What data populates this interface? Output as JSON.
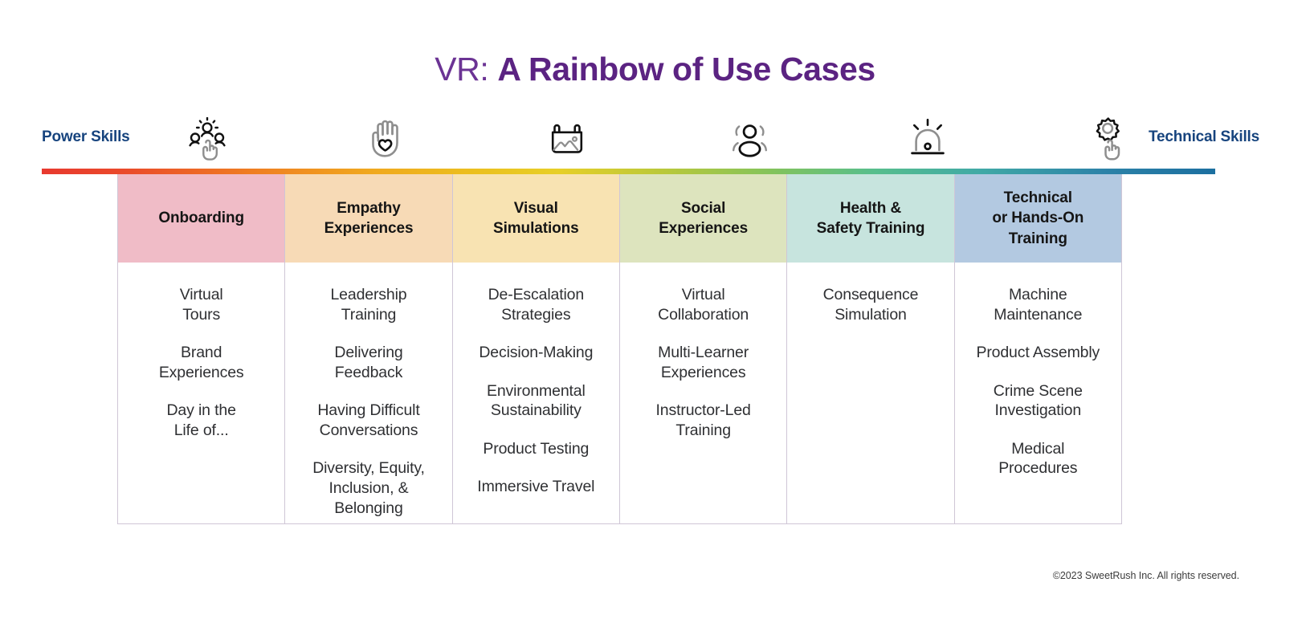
{
  "title": {
    "prefix": "VR: ",
    "main": "A Rainbow of Use Cases",
    "prefix_color": "#6b3394",
    "main_color": "#5b2382"
  },
  "axis": {
    "left_label": "Power Skills",
    "right_label": "Technical Skills",
    "label_color": "#17447e",
    "gradient_stops": [
      "#e8392f",
      "#ef7e22",
      "#f0a81f",
      "#ebc01f",
      "#b9c83b",
      "#84c35b",
      "#41a9a6",
      "#1c6fa0"
    ]
  },
  "icons": [
    {
      "name": "team-people-pointer-icon",
      "alt": "group of three people with pointing hand"
    },
    {
      "name": "hand-heart-icon",
      "alt": "open hand with heart in palm"
    },
    {
      "name": "landscape-picture-icon",
      "alt": "hanging picture of a landscape"
    },
    {
      "name": "social-avatars-icon",
      "alt": "two overlapping person avatars"
    },
    {
      "name": "alarm-siren-icon",
      "alt": "emergency siren light with rays"
    },
    {
      "name": "gear-hand-icon",
      "alt": "gear with pointing hand"
    }
  ],
  "columns": [
    {
      "header": "Onboarding",
      "header_lines": [
        "Onboarding"
      ],
      "color": "#f0bcc7",
      "items": [
        "Virtual\nTours",
        "Brand\nExperiences",
        "Day in the\nLife of..."
      ]
    },
    {
      "header": "Empathy Experiences",
      "header_lines": [
        "Empathy",
        "Experiences"
      ],
      "color": "#f7dab6",
      "items": [
        "Leadership\nTraining",
        "Delivering\nFeedback",
        "Having Difficult\nConversations",
        "Diversity, Equity,\nInclusion, &\nBelonging"
      ]
    },
    {
      "header": "Visual Simulations",
      "header_lines": [
        "Visual",
        "Simulations"
      ],
      "color": "#f8e3b2",
      "items": [
        "De-Escalation\nStrategies",
        "Decision-Making",
        "Environmental\nSustainability",
        "Product Testing",
        "Immersive Travel"
      ]
    },
    {
      "header": "Social Experiences",
      "header_lines": [
        "Social",
        "Experiences"
      ],
      "color": "#dde4be",
      "items": [
        "Virtual\nCollaboration",
        "Multi-Learner\nExperiences",
        "Instructor-Led\nTraining"
      ]
    },
    {
      "header": "Health & Safety Training",
      "header_lines": [
        "Health &",
        "Safety Training"
      ],
      "color": "#c7e4de",
      "items": [
        "Consequence\nSimulation"
      ]
    },
    {
      "header": "Technical or Hands-On Training",
      "header_lines": [
        "Technical",
        "or Hands-On",
        "Training"
      ],
      "color": "#b4caa.0"
    }
  ],
  "columns_fix": {
    "col6_color": "#b3c9e1",
    "col6_items": [
      "Machine\nMaintenance",
      "Product Assembly",
      "Crime Scene\nInvestigation",
      "Medical\nProcedures"
    ]
  },
  "footer": {
    "copyright": "©2023 SweetRush Inc. All rights reserved."
  }
}
